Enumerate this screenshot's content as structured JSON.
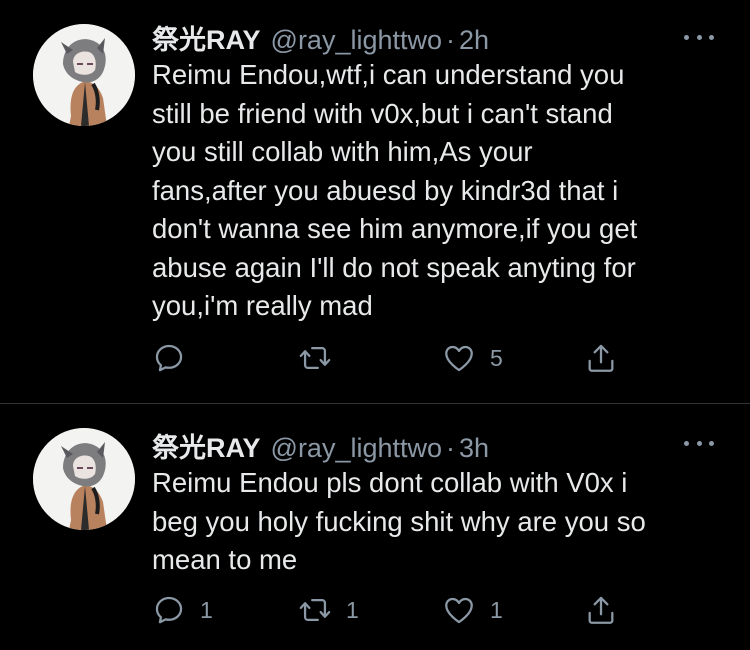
{
  "tweets": [
    {
      "display_name": "祭光RAY",
      "handle": "@ray_lighttwo",
      "separator": "·",
      "time": "2h",
      "text": "Reimu Endou,wtf,i can understand you\nstill be friend with v0x,but i can't stand\nyou still collab with him,As your\nfans,after you abuesd by kindr3d that i\ndon't wanna see him anymore,if you get\nabuse again I'll do not speak anyting for\nyou,i'm really mad",
      "replies": "",
      "retweets": "",
      "likes": "5"
    },
    {
      "display_name": "祭光RAY",
      "handle": "@ray_lighttwo",
      "separator": "·",
      "time": "3h",
      "text": "Reimu Endou pls dont collab with V0x i\nbeg you holy fucking shit why are you so\nmean to me",
      "replies": "1",
      "retweets": "1",
      "likes": "1"
    }
  ],
  "icons": {
    "reply": "reply-icon",
    "retweet": "retweet-icon",
    "like": "heart-icon",
    "share": "share-icon",
    "more": "more-icon"
  },
  "colors": {
    "background": "#000000",
    "text": "#e7e9ea",
    "secondary": "#8b98a5",
    "divider": "#2f3336"
  }
}
